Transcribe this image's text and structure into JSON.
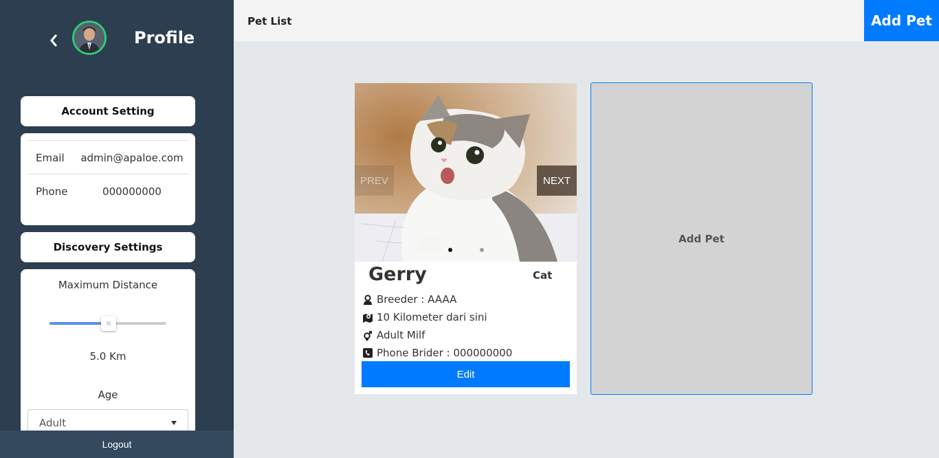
{
  "sidebar": {
    "title": "Profile",
    "account_setting_label": "Account Setting",
    "account": {
      "email_label": "Email",
      "email_value": "admin@apaloe.com",
      "phone_label": "Phone",
      "phone_value": "000000000"
    },
    "discovery_settings_label": "Discovery Settings",
    "discovery": {
      "max_distance_label": "Maximum Distance",
      "max_distance_fraction": 0.5,
      "distance_value": "5.0 Km",
      "age_label": "Age",
      "age_selected": "Adult"
    },
    "logout_label": "Logout"
  },
  "header": {
    "page_title": "Pet List",
    "add_pet_label": "Add Pet"
  },
  "pet": {
    "prev_label": "PREV",
    "next_label": "NEXT",
    "name": "Gerry",
    "type": "Cat",
    "breeder": "Breeder : AAAA",
    "distance": "10 Kilometer dari sini",
    "gender_age": "Adult Milf",
    "phone": "Phone Brider : 000000000",
    "edit_label": "Edit",
    "slides": 2,
    "active_slide": 1
  },
  "add_pet_card_label": "Add Pet",
  "colors": {
    "sidebar_bg": "#2c3e50",
    "primary": "#007bff",
    "avatar_ring": "#2ecc71",
    "slider_fill": "#5a8dee"
  },
  "icons": {
    "back": "chevron-left-icon",
    "breeder": "user-icon",
    "distance": "map-icon",
    "gender": "gender-icon",
    "phone": "phone-icon",
    "select": "caret-down-icon"
  }
}
